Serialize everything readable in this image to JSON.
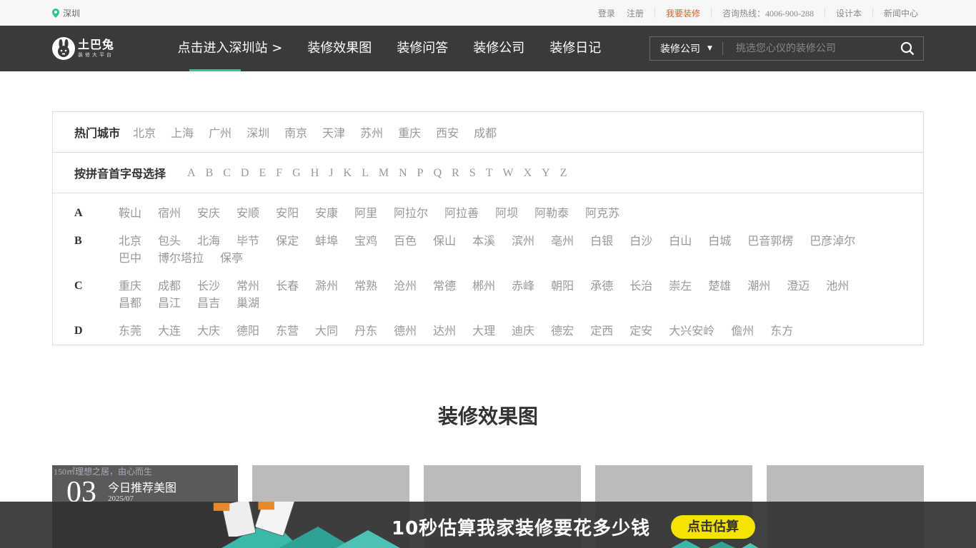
{
  "topbar": {
    "city": "深圳",
    "links": {
      "login": "登录",
      "register": "注册",
      "want_decor": "我要装修",
      "hotline": "咨询热线：4006-900-288",
      "designer": "设计本",
      "news": "新闻中心"
    }
  },
  "nav": {
    "logo_name": "土巴兔",
    "logo_sub": "装修大平台",
    "menu": [
      "点击进入深圳站 >",
      "装修效果图",
      "装修问答",
      "装修公司",
      "装修日记"
    ],
    "search_category": "装修公司",
    "search_placeholder": "挑选您心仪的装修公司"
  },
  "city_selector": {
    "hot_label": "热门城市",
    "hot_cities": [
      "北京",
      "上海",
      "广州",
      "深圳",
      "南京",
      "天津",
      "苏州",
      "重庆",
      "西安",
      "成都"
    ],
    "pinyin_label": "按拼音首字母选择",
    "letters": [
      "A",
      "B",
      "C",
      "D",
      "E",
      "F",
      "G",
      "H",
      "J",
      "K",
      "L",
      "M",
      "N",
      "P",
      "Q",
      "R",
      "S",
      "T",
      "W",
      "X",
      "Y",
      "Z"
    ],
    "groups": [
      {
        "key": "A",
        "cities": [
          "鞍山",
          "宿州",
          "安庆",
          "安顺",
          "安阳",
          "安康",
          "阿里",
          "阿拉尔",
          "阿拉善",
          "阿坝",
          "阿勒泰",
          "阿克苏"
        ]
      },
      {
        "key": "B",
        "cities": [
          "北京",
          "包头",
          "北海",
          "毕节",
          "保定",
          "蚌埠",
          "宝鸡",
          "百色",
          "保山",
          "本溪",
          "滨州",
          "亳州",
          "白银",
          "白沙",
          "白山",
          "白城",
          "巴音郭楞",
          "巴彦淖尔",
          "巴中",
          "博尔塔拉",
          "保亭"
        ]
      },
      {
        "key": "C",
        "cities": [
          "重庆",
          "成都",
          "长沙",
          "常州",
          "长春",
          "滁州",
          "常熟",
          "沧州",
          "常德",
          "郴州",
          "赤峰",
          "朝阳",
          "承德",
          "长治",
          "崇左",
          "楚雄",
          "潮州",
          "澄迈",
          "池州",
          "昌都",
          "昌江",
          "昌吉",
          "巢湖"
        ]
      },
      {
        "key": "D",
        "cities": [
          "东莞",
          "大连",
          "大庆",
          "德阳",
          "东营",
          "大同",
          "丹东",
          "德州",
          "达州",
          "大理",
          "迪庆",
          "德宏",
          "定西",
          "定安",
          "大兴安岭",
          "儋州",
          "东方"
        ]
      }
    ]
  },
  "section": {
    "title": "装修效果图"
  },
  "featured": {
    "image_alt": "150㎡理想之居，由心而生",
    "day": "03",
    "label": "今日推荐美图",
    "date": "2025/07"
  },
  "banner": {
    "text": "10秒估算我家装修要花多少钱",
    "button": "点击估算"
  }
}
